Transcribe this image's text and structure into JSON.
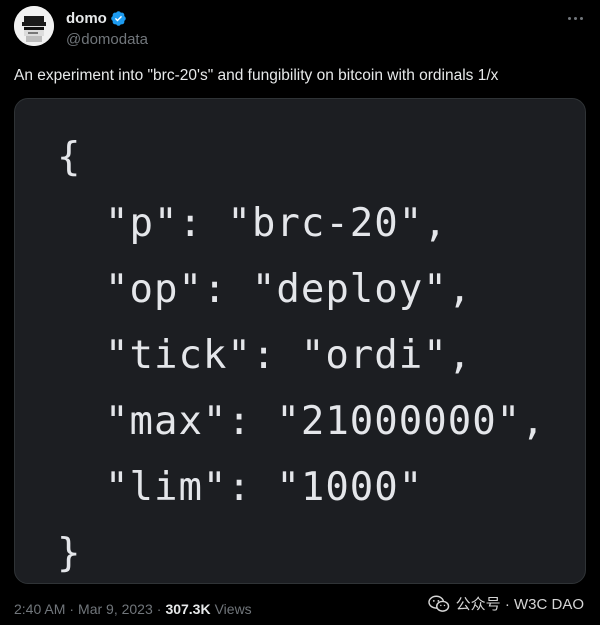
{
  "author": {
    "display_name": "domo",
    "handle": "@domodata",
    "verified": true
  },
  "tweet": {
    "text": "An experiment into \"brc-20's\" and fungibility on bitcoin with ordinals 1/x"
  },
  "code_image": {
    "lines": [
      {
        "text": "{",
        "indent": 0
      },
      {
        "text": "\"p\": \"brc-20\",",
        "indent": 1
      },
      {
        "text": "\"op\": \"deploy\",",
        "indent": 1
      },
      {
        "text": "\"tick\": \"ordi\",",
        "indent": 1
      },
      {
        "text": "\"max\": \"21000000\",",
        "indent": 1
      },
      {
        "text": "\"lim\": \"1000\"",
        "indent": 1
      },
      {
        "text": "}",
        "indent": 0
      }
    ]
  },
  "meta": {
    "time": "2:40 AM",
    "separator": "·",
    "date": "Mar 9, 2023",
    "views_count": "307.3K",
    "views_label": "Views"
  },
  "watermark": {
    "text": "公众号 · W3C DAO"
  },
  "colors": {
    "background": "#000000",
    "verified_badge": "#1d9bf0",
    "muted": "#71767b",
    "code_bg": "#1c1e22"
  },
  "icons": {
    "more": "more-horizontal-icon",
    "verified": "verified-badge-icon",
    "watermark": "wechat-icon"
  }
}
